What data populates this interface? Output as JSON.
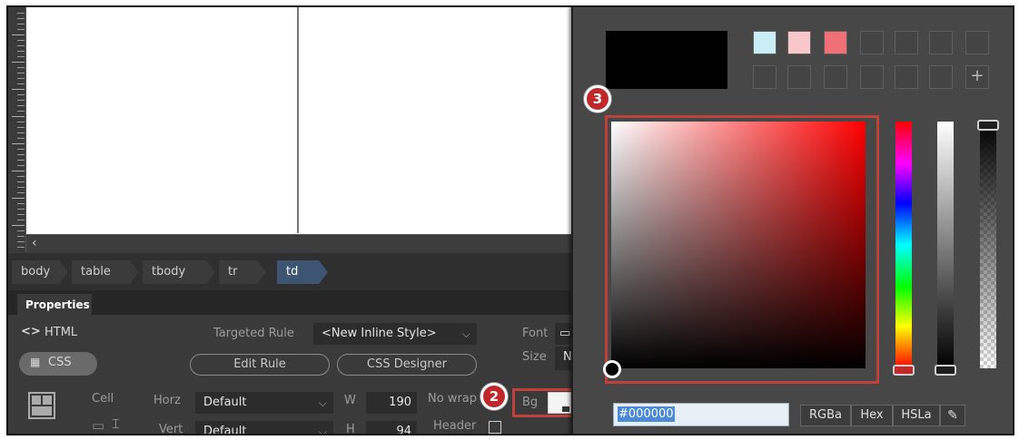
{
  "tagbar": {
    "crumbs": [
      "body",
      "table",
      "tbody",
      "tr",
      "td"
    ],
    "active": "td"
  },
  "properties": {
    "tab_label": "Properties",
    "html_label": "HTML",
    "css_label": "CSS",
    "targeted_rule_label": "Targeted Rule",
    "targeted_rule_value": "<New Inline Style>",
    "edit_rule_label": "Edit Rule",
    "css_designer_label": "CSS Designer",
    "font_label": "Font",
    "size_label": "Size",
    "size_value_partial": "N",
    "cell_label": "Cell",
    "horz_label": "Horz",
    "horz_value": "Default",
    "vert_label": "Vert",
    "vert_value": "Default",
    "w_label": "W",
    "w_value": "190",
    "h_label": "H",
    "h_value": "94",
    "nowrap_label": "No wrap",
    "header_label": "Header",
    "bg_label": "Bg"
  },
  "badges": {
    "step2": "2",
    "step3": "3"
  },
  "picker": {
    "current_color": "#000000",
    "hex_value": "#000000",
    "swatches": [
      "#c9eef5",
      "#f7c7c9",
      "#f07078"
    ],
    "add_swatch_label": "+",
    "modes": [
      "RGBa",
      "Hex",
      "HSLa"
    ],
    "accent": "#c0403a"
  }
}
